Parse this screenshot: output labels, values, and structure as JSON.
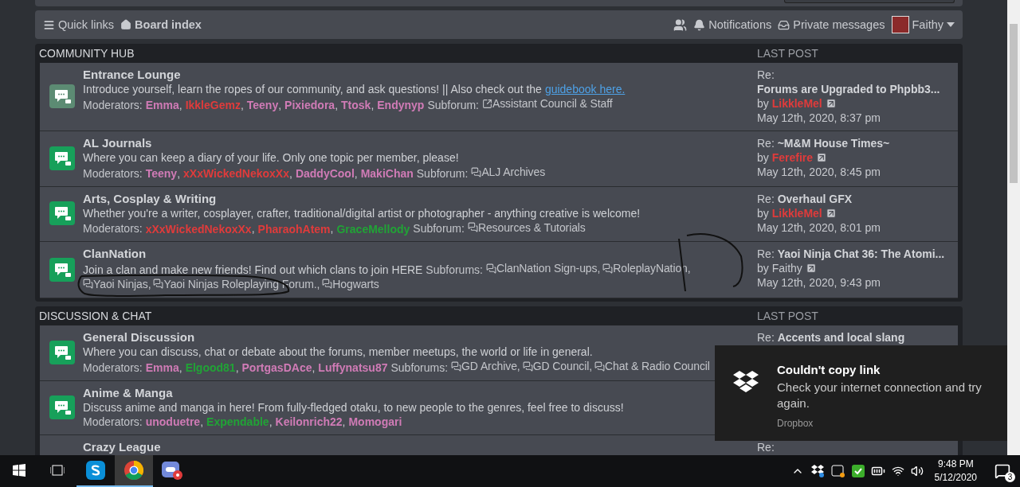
{
  "navbar": {
    "quick_links": "Quick links",
    "board_index": "Board index",
    "notifications": "Notifications",
    "private_messages": "Private messages",
    "user": "Faithy"
  },
  "sections": [
    {
      "title": "COMMUNITY HUB",
      "last_post_header": "LAST POST",
      "forums": [
        {
          "name": "Entrance Lounge",
          "unread": false,
          "description": "Introduce yourself, learn the ropes of our community, and ask questions! || Also check out the",
          "link": "guidebook here.",
          "moderators_label": "Moderators:",
          "moderators": [
            {
              "name": "Emma",
              "color": "#d07bb6",
              "sep": ","
            },
            {
              "name": "IkkleGemz",
              "color": "#e03b3b",
              "sep": ","
            },
            {
              "name": "Teeny",
              "color": "#d07bb6",
              "sep": ","
            },
            {
              "name": "Pixiedora",
              "color": "#d07bb6",
              "sep": ","
            },
            {
              "name": "Ttosk",
              "color": "#d07bb6",
              "sep": ","
            },
            {
              "name": "Endynyp",
              "color": "#d07bb6"
            }
          ],
          "subforum_label": "Subforum:",
          "subforums": [
            {
              "kind": "link",
              "name": "Assistant Council & Staff"
            }
          ],
          "last_post": {
            "prefix": "Re:",
            "title": "Forums are Upgraded to Phpbb3...",
            "by": "by",
            "author": {
              "name": "LikkleMel",
              "color": "#e03b3b"
            },
            "date": "May 12th, 2020, 8:37 pm"
          }
        },
        {
          "name": "AL Journals",
          "unread": true,
          "description": "Where you can keep a diary of your life. Only one topic per member, please!",
          "moderators_label": "Moderators:",
          "moderators": [
            {
              "name": "Teeny",
              "color": "#d07bb6",
              "sep": ","
            },
            {
              "name": "xXxWickedNekoxXx",
              "color": "#e03b3b",
              "sep": ","
            },
            {
              "name": "DaddyCool",
              "color": "#d07bb6",
              "sep": ","
            },
            {
              "name": "MakiChan",
              "color": "#d07bb6"
            }
          ],
          "subforum_label": "Subforum:",
          "subforums": [
            {
              "kind": "forum",
              "name": "ALJ Archives"
            }
          ],
          "last_post": {
            "prefix": "Re:",
            "title": "~M&M House Times~",
            "by": "by",
            "author": {
              "name": "Ferefire",
              "color": "#e03b3b"
            },
            "date": "May 12th, 2020, 8:45 pm"
          }
        },
        {
          "name": "Arts, Cosplay & Writing",
          "unread": true,
          "description": "Whether you're a writer, cosplayer, crafter, traditional/digital artist or photographer - anything creative is welcome!",
          "moderators_label": "Moderators:",
          "moderators": [
            {
              "name": "xXxWickedNekoxXx",
              "color": "#e03b3b",
              "sep": ","
            },
            {
              "name": "PharaohAtem",
              "color": "#e03b3b",
              "sep": ","
            },
            {
              "name": "GraceMellody",
              "color": "#21a336"
            }
          ],
          "subforum_label": "Subforum:",
          "subforums": [
            {
              "kind": "forum",
              "name": "Resources & Tutorials"
            }
          ],
          "last_post": {
            "prefix": "Re:",
            "title": "Overhaul GFX",
            "by": "by",
            "author": {
              "name": "LikkleMel",
              "color": "#e03b3b"
            },
            "date": "May 12th, 2020, 8:01 pm"
          }
        },
        {
          "name": "ClanNation",
          "unread": true,
          "description": "Join a clan and make new friends! Find out which clans to join HERE",
          "subforum_label": "Subforums:",
          "subforums": [
            {
              "kind": "forum",
              "name": "ClanNation Sign-ups,"
            },
            {
              "kind": "forum",
              "name": "RoleplayNation,"
            },
            {
              "kind": "forum",
              "name": "Yaoi Ninjas,"
            },
            {
              "kind": "forum",
              "name": "Yaoi Ninjas Roleplaying Forum.,"
            },
            {
              "kind": "forum",
              "name": "Hogwarts"
            }
          ],
          "last_post": {
            "prefix": "Re:",
            "title": "Yaoi Ninja Chat 36: The Atomi...",
            "by": "by",
            "author": {
              "name": "Faithy"
            },
            "date": "May 12th, 2020, 9:43 pm"
          }
        }
      ]
    },
    {
      "title": "DISCUSSION & CHAT",
      "last_post_header": "LAST POST",
      "forums": [
        {
          "name": "General Discussion",
          "unread": true,
          "description": "Where you can discuss, chat or debate about the forums, member meetups, the world or life in general.",
          "moderators_label": "Moderators:",
          "moderators": [
            {
              "name": "Emma",
              "color": "#d07bb6",
              "sep": ","
            },
            {
              "name": "Elgood81",
              "color": "#21a336",
              "sep": ","
            },
            {
              "name": "PortgasDAce",
              "color": "#d07bb6",
              "sep": ","
            },
            {
              "name": "Luffynatsu87",
              "color": "#d07bb6"
            }
          ],
          "subforum_label": "Subforums:",
          "subforums": [
            {
              "kind": "forum",
              "name": "GD Archive,"
            },
            {
              "kind": "forum",
              "name": "GD Council,"
            },
            {
              "kind": "forum",
              "name": "Chat & Radio Council"
            }
          ],
          "last_post": {
            "prefix": "Re:",
            "title": "Accents and local slang"
          }
        },
        {
          "name": "Anime & Manga",
          "unread": true,
          "description": "Discuss anime and manga in here! From fully-fledged otaku, to new people to the genres, feel free to discuss!",
          "moderators_label": "Moderators:",
          "moderators": [
            {
              "name": "unoduetre",
              "color": "#d07bb6",
              "sep": ","
            },
            {
              "name": "Expendable",
              "color": "#21a336",
              "sep": ","
            },
            {
              "name": "Keilonrich22",
              "color": "#d07bb6",
              "sep": ","
            },
            {
              "name": "Momogari",
              "color": "#d07bb6"
            }
          ]
        },
        {
          "name": "Crazy League",
          "last_post": {
            "prefix": "Re:"
          }
        }
      ]
    }
  ],
  "toast": {
    "title": "Couldn't copy link",
    "message": "Check your internet connection and try again.",
    "app": "Dropbox"
  },
  "taskbar": {
    "time": "9:48 PM",
    "date": "5/12/2020",
    "notification_count": "3"
  }
}
